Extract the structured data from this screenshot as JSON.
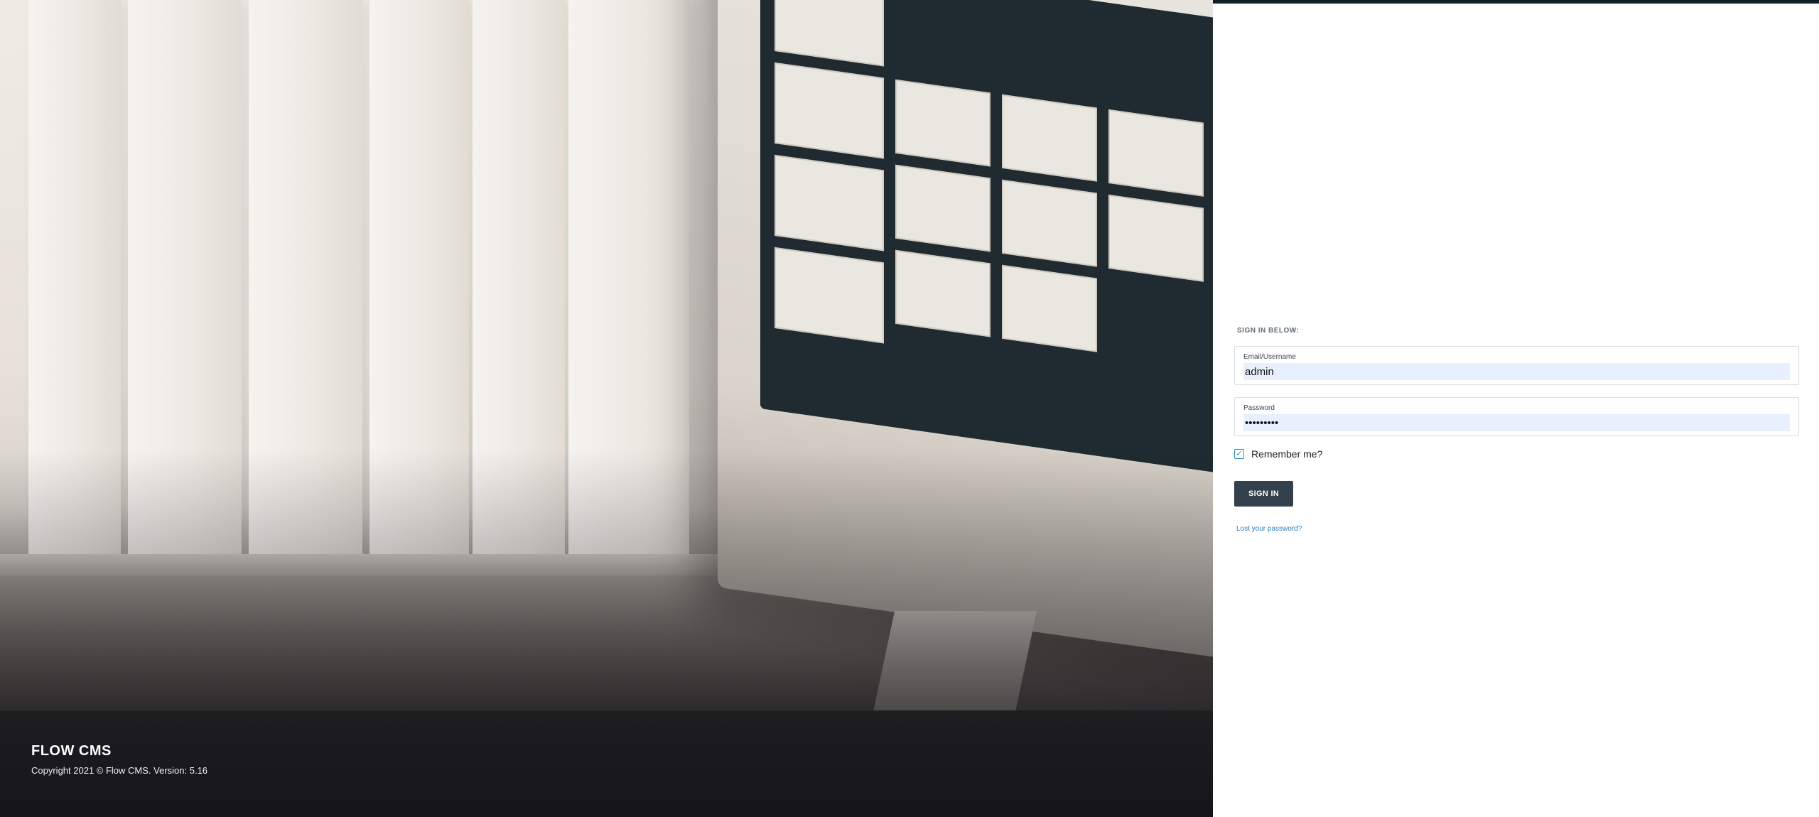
{
  "brand": {
    "name": "FLOW CMS",
    "copyright": "Copyright 2021 © Flow CMS. Version: 5.16"
  },
  "form": {
    "title": "SIGN IN BELOW:",
    "email_label": "Email/Username",
    "email_value": "admin",
    "password_label": "Password",
    "password_value": "secretpwd",
    "remember_label": "Remember me?",
    "remember_checked": true,
    "sign_in_label": "SIGN IN",
    "lost_password_label": "Lost your password?"
  },
  "colors": {
    "accent": "#2f7fbf",
    "button": "#34404c",
    "topbar": "#0f2027",
    "autofill": "#e8f0fe"
  },
  "icons": {
    "checkbox": "check-icon"
  }
}
